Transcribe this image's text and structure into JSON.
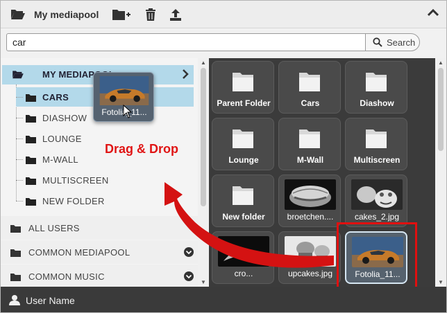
{
  "header": {
    "title": "My mediapool",
    "icons": [
      "folder-open-icon",
      "new-folder-icon",
      "trash-icon",
      "upload-icon",
      "chevron-up-icon"
    ]
  },
  "search": {
    "value": "car",
    "button_label": "Search"
  },
  "sidebar": {
    "root_label": "MY MEDIAPOOL",
    "folders": [
      {
        "label": "CARS",
        "active": true
      },
      {
        "label": "DIASHOW"
      },
      {
        "label": "LOUNGE"
      },
      {
        "label": "M-WALL"
      },
      {
        "label": "MULTISCREEN"
      },
      {
        "label": "NEW FOLDER"
      }
    ],
    "groups": [
      {
        "label": "ALL USERS"
      },
      {
        "label": "COMMON MEDIAPOOL",
        "expandable": true
      },
      {
        "label": "COMMON MUSIC",
        "expandable": true
      }
    ]
  },
  "content": {
    "tiles": [
      {
        "label": "Parent Folder",
        "kind": "folder"
      },
      {
        "label": "Cars",
        "kind": "folder"
      },
      {
        "label": "Diashow",
        "kind": "folder"
      },
      {
        "label": "Lounge",
        "kind": "folder"
      },
      {
        "label": "M-Wall",
        "kind": "folder"
      },
      {
        "label": "Multiscreen",
        "kind": "folder"
      },
      {
        "label": "New folder",
        "kind": "folder"
      },
      {
        "label": "broetchen....",
        "kind": "image"
      },
      {
        "label": "cakes_2.jpg",
        "kind": "image"
      },
      {
        "label": "cro...",
        "kind": "image"
      },
      {
        "label": "upcakes.jpg",
        "kind": "image"
      },
      {
        "label": "Fotolia_11...",
        "kind": "image",
        "selected": true
      }
    ]
  },
  "drag": {
    "ghost_label": "Fotolia_11...",
    "annotation": "Drag & Drop"
  },
  "footer": {
    "user_name": "User Name"
  },
  "colors": {
    "accent_selection": "#b3d9ea",
    "content_bg": "#3b3b3b",
    "annotation_red": "#e01010"
  }
}
